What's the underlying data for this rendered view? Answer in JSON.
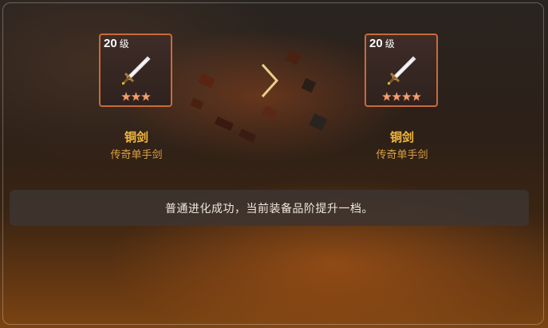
{
  "before": {
    "level_num": "20",
    "level_unit": "级",
    "star_count": 3,
    "stars": "★★★",
    "name": "铜剑",
    "type": "传奇单手剑",
    "icon": "sword-icon"
  },
  "after": {
    "level_num": "20",
    "level_unit": "级",
    "star_count": 4,
    "stars": "★★★★",
    "name": "铜剑",
    "type": "传奇单手剑",
    "icon": "sword-icon"
  },
  "arrow_icon": "chevron-right-icon",
  "message": "普通进化成功，当前装备品阶提升一档。",
  "colors": {
    "card_border": "#c86a3c",
    "item_name": "#f3b93e",
    "item_type": "#dba242",
    "star": "#f0a070"
  }
}
